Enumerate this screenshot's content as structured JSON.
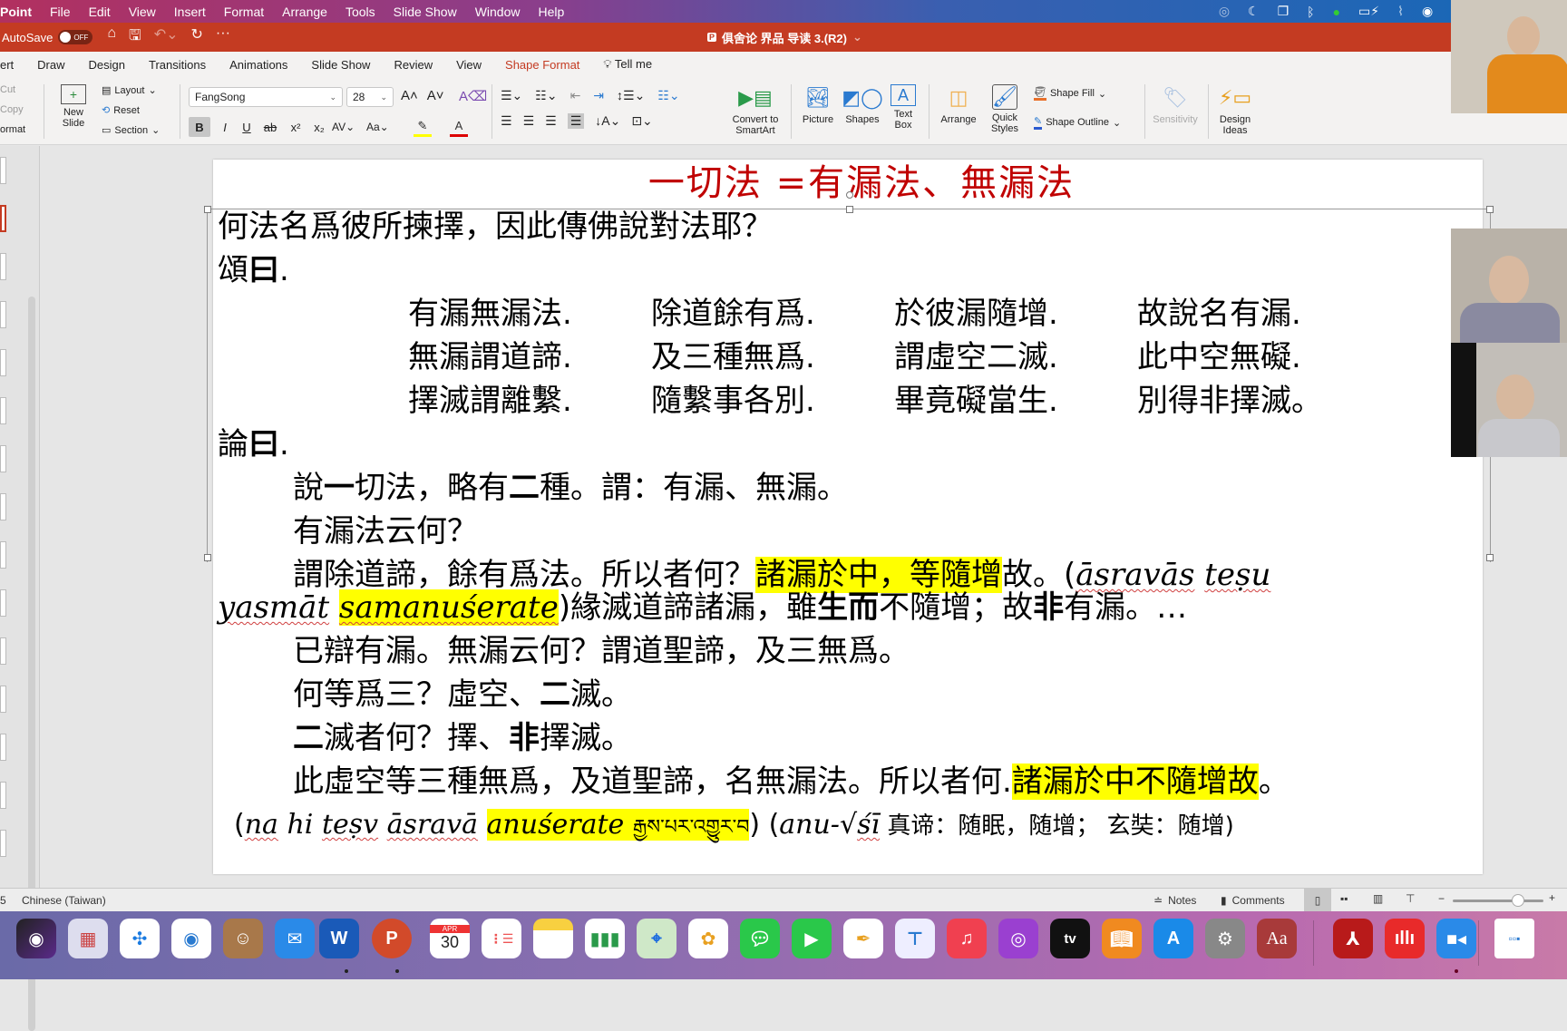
{
  "menubar": {
    "app": "Point",
    "items": [
      "File",
      "Edit",
      "View",
      "Insert",
      "Format",
      "Arrange",
      "Tools",
      "Slide Show",
      "Window",
      "Help"
    ],
    "status_icons": [
      "creative-cloud-icon",
      "moon-icon",
      "screen-mirror-icon",
      "bluetooth-icon",
      "input-source-icon",
      "battery-charging-icon",
      "wifi-off-icon",
      "user-icon",
      "search-icon"
    ]
  },
  "titlebar": {
    "autosave_label": "AutoSave",
    "autosave_state": "OFF",
    "document_title": "俱舍论 界品 导读 3.(R2)",
    "colors": {
      "titlebar": "#c43b22",
      "accent": "#c43b22"
    }
  },
  "ribbon_tabs": [
    "ert",
    "Draw",
    "Design",
    "Transitions",
    "Animations",
    "Slide Show",
    "Review",
    "View",
    "Shape Format",
    "Tell me"
  ],
  "ribbon_active_tab": "Shape Format",
  "ribbon": {
    "clipboard": {
      "cut": "Cut",
      "copy": "Copy",
      "format": "ormat"
    },
    "new_slide": "New\nSlide",
    "layout": "Layout",
    "reset": "Reset",
    "section": "Section",
    "font_name": "FangSong",
    "font_size": "28",
    "convert_smartart": "Convert to\nSmartArt",
    "picture": "Picture",
    "shapes": "Shapes",
    "text_box": "Text\nBox",
    "arrange": "Arrange",
    "quick_styles": "Quick\nStyles",
    "shape_fill": "Shape Fill",
    "shape_outline": "Shape Outline",
    "sensitivity": "Sensitivity",
    "design_ideas": "Design\nIdeas"
  },
  "slide": {
    "title": "一切法 =有漏法、無漏法",
    "title_color": "#c00000",
    "line1": "何法名爲彼所揀擇，因此傳佛說對法耶？",
    "song_label_a": "頌",
    "song_label_b": "曰",
    "song_dot": ".",
    "verses": [
      [
        "有漏無漏法.",
        "除道餘有爲.",
        "於彼漏隨增.",
        "故說名有漏."
      ],
      [
        "無漏謂道諦.",
        "及三種無爲.",
        "謂虛空二滅.",
        "此中空無礙."
      ],
      [
        "擇滅謂離繫.",
        "隨繫事各別.",
        "畢竟礙當生.",
        "別得非擇滅。"
      ]
    ],
    "lun_label_a": "論",
    "lun_label_b": "曰",
    "lun_dot": ".",
    "p1a": "說",
    "p1b": "一",
    "p1c": "切法，略有",
    "p1d": "二",
    "p1e": "種。謂：有漏、無漏。",
    "p2": "有漏法云何？",
    "p3a": "謂除道諦，餘有爲法。所以者何？",
    "p3_hl": "諸漏於中，等隨增",
    "p3b": "故。(",
    "p3_skt1": "āsravās",
    "p3_skt2": "teṣu",
    "p4_skt1": "yasmāt",
    "p4_skt2": "samanuśerate",
    "p4a": ")緣滅道諦諸漏，雖",
    "p4b": "生而",
    "p4c": "不隨增；故",
    "p4d": "非",
    "p4e": "有漏。…",
    "p5": "已辯有漏。無漏云何？謂道聖諦，及三無爲。",
    "p6a": "何等爲三？虛空、",
    "p6b": "二",
    "p6c": "滅。",
    "p7a": "二",
    "p7b": "滅者何？擇、",
    "p7c": "非",
    "p7d": "擇滅。",
    "p8a": "此虛空等三種無爲，及道聖諦，名無漏法。所以者何.",
    "p8_hl": "諸漏於中不隨增故",
    "p8b": "。",
    "p9a": "(",
    "p9_skt1": "na",
    "p9_skt2": "hi",
    "p9_skt3": "teṣv",
    "p9_skt4": "āsravā",
    "p9_hl": "anuśerate",
    "p9_tib": "རྒྱས་པར་འགྱུར་བ",
    "p9b": ") (",
    "p9_skt5": "anu-√",
    "p9_skt6": "śī",
    "p9c": " 真谛：随眠，随增； 玄奘：随增)",
    "highlight_color": "#ffff00"
  },
  "statusbar": {
    "slide_indicator": "5",
    "language": "Chinese (Taiwan)",
    "notes": "Notes",
    "comments": "Comments",
    "zoom_fraction": 0.72
  },
  "dock": {
    "apps": [
      "Siri",
      "Launchpad",
      "Safari",
      "Chrome",
      "Contacts",
      "Mail",
      "Word",
      "PowerPoint",
      "Calendar",
      "Reminders",
      "Notes",
      "Numbers",
      "Maps",
      "Photos",
      "Messages",
      "FaceTime",
      "Pages",
      "Keynote",
      "Music",
      "Podcasts",
      "Apple TV",
      "Books",
      "App Store",
      "System Preferences",
      "Dictionary",
      "Acrobat",
      "Voice Memos",
      "Zoom",
      "Zoom Window"
    ],
    "calendar_month": "APR",
    "calendar_day": "30"
  }
}
